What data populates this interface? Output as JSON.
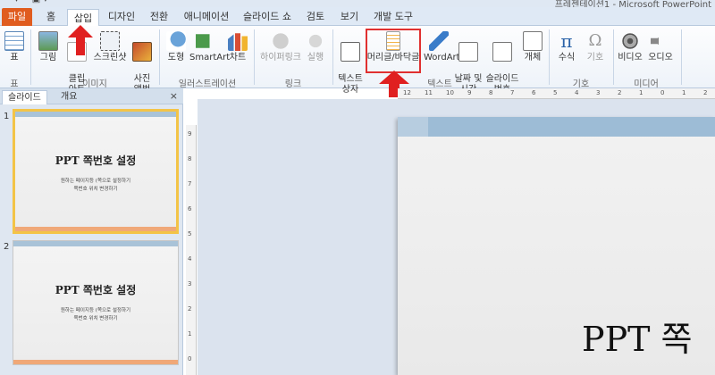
{
  "window": {
    "title": "프레젠테이션1 - Microsoft PowerPoint"
  },
  "tabs": [
    "파일",
    "홈",
    "삽입",
    "디자인",
    "전환",
    "애니메이션",
    "슬라이드 쇼",
    "검토",
    "보기",
    "개발 도구"
  ],
  "ribbon": {
    "table": "표",
    "image": "그림",
    "clipart": "클립\n아트",
    "screenshot": "스크린샷",
    "album": "사진\n앨범",
    "shape": "도형",
    "smartart": "SmartArt",
    "chart": "차트",
    "hyperlink": "하이퍼링크",
    "action": "실행",
    "textbox": "텍스트\n상자",
    "headerfooter": "머리글/바닥글",
    "wordart": "WordArt",
    "datetime": "날짜 및\n시간",
    "slidenum": "슬라이드\n번호",
    "object": "개체",
    "equation": "수식",
    "symbol": "기호",
    "video": "비디오",
    "audio": "오디오"
  },
  "groups": {
    "table": "표",
    "images": "이미지",
    "illustrations": "일러스트레이션",
    "links": "링크",
    "text": "텍스트",
    "symbols": "기호",
    "media": "미디어"
  },
  "panel": {
    "tab_slides": "슬라이드",
    "tab_outline": "개요",
    "close": "×"
  },
  "slides": [
    {
      "num": "1",
      "title": "PPT 쪽번호 설정",
      "sub1": "원하는 페이지등 (쪽으로 설정하기",
      "sub2": "쪽번호 위치 변경하기"
    },
    {
      "num": "2",
      "title": "PPT 쪽번호 설정",
      "sub1": "원하는 페이지등 (쪽으로 설정하기",
      "sub2": "쪽번호 위치 변경하기"
    }
  ],
  "main_slide": {
    "title_visible": "PPT 쪽"
  },
  "ruler": {
    "h": [
      "12",
      "11",
      "10",
      "9",
      "8",
      "7",
      "6",
      "5",
      "4",
      "3",
      "2",
      "1",
      "0",
      "1",
      "2"
    ],
    "v": [
      "9",
      "8",
      "7",
      "6",
      "5",
      "4",
      "3",
      "2",
      "1",
      "0"
    ]
  },
  "colors": {
    "accent": "#e05c1f",
    "annotation": "#e03030",
    "thumb_select": "#f3c447"
  }
}
